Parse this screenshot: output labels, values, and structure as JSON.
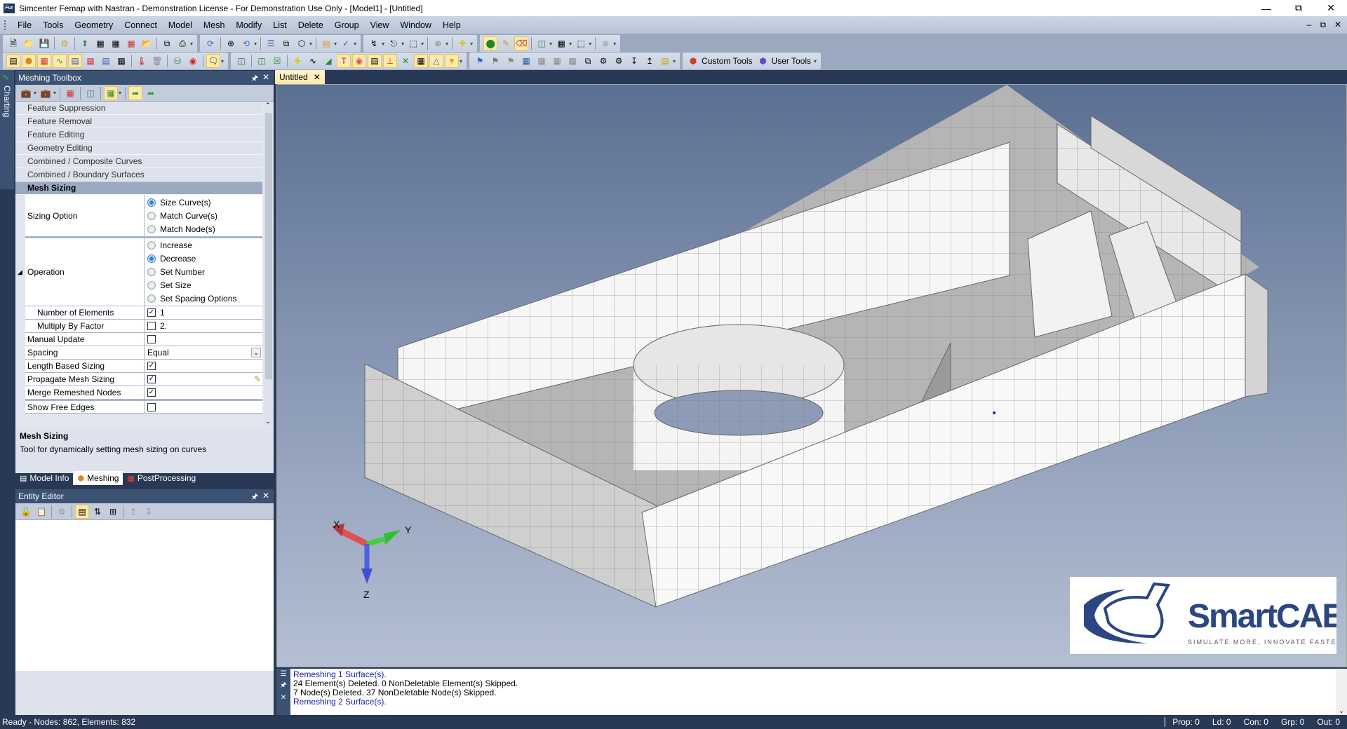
{
  "window": {
    "title": "Simcenter Femap with Nastran - Demonstration License - For Demonstration Use Only - [Model1] - [Untitled]",
    "app_icon": "Fur",
    "controls": [
      "minimize",
      "restore",
      "close"
    ]
  },
  "menu": [
    "File",
    "Tools",
    "Geometry",
    "Connect",
    "Model",
    "Mesh",
    "Modify",
    "List",
    "Delete",
    "Group",
    "View",
    "Window",
    "Help"
  ],
  "toolbar": {
    "custom_tools_label": "Custom Tools",
    "user_tools_label": "User Tools"
  },
  "side_strip": {
    "label": "Charting"
  },
  "meshing_toolbox": {
    "title": "Meshing Toolbox",
    "sections": [
      "Feature Suppression",
      "Feature Removal",
      "Feature Editing",
      "Geometry Editing",
      "Combined / Composite Curves",
      "Combined / Boundary Surfaces"
    ],
    "active_section": "Mesh Sizing",
    "properties": {
      "sizing_option": {
        "label": "Sizing Option",
        "options": [
          "Size Curve(s)",
          "Match Curve(s)",
          "Match Node(s)"
        ],
        "selected": "Size Curve(s)"
      },
      "operation": {
        "label": "Operation",
        "options": [
          "Increase",
          "Decrease",
          "Set Number",
          "Set Size",
          "Set Spacing Options"
        ],
        "selected": "Decrease"
      },
      "number_of_elements": {
        "label": "Number of Elements",
        "checked": true,
        "value": "1"
      },
      "multiply_by_factor": {
        "label": "Multiply By Factor",
        "checked": false,
        "value": "2."
      },
      "manual_update": {
        "label": "Manual Update",
        "checked": false
      },
      "spacing": {
        "label": "Spacing",
        "value": "Equal"
      },
      "length_based_sizing": {
        "label": "Length Based Sizing",
        "checked": true
      },
      "propagate_mesh_sizing": {
        "label": "Propagate Mesh Sizing",
        "checked": true
      },
      "merge_remeshed_nodes": {
        "label": "Merge Remeshed Nodes",
        "checked": true
      },
      "show_free_edges": {
        "label": "Show Free Edges",
        "checked": false
      }
    },
    "description": {
      "title": "Mesh Sizing",
      "text": "Tool for dynamically setting mesh sizing on curves"
    }
  },
  "bottom_tabs": [
    {
      "label": "Model Info",
      "active": false
    },
    {
      "label": "Meshing",
      "active": true
    },
    {
      "label": "PostProcessing",
      "active": false
    }
  ],
  "entity_editor": {
    "title": "Entity Editor"
  },
  "document_tabs": [
    {
      "label": "Untitled",
      "active": true
    }
  ],
  "viewport": {
    "axes": {
      "x": "X",
      "y": "Y",
      "z": "Z"
    },
    "colors": {
      "x": "#e05050",
      "y": "#40d040",
      "z": "#5060e0"
    },
    "logo": {
      "name": "SmartCAE",
      "tagline": "SIMULATE MORE, INNOVATE FASTER",
      "color": "#2b4680"
    }
  },
  "messages": [
    {
      "text": "Remeshing 1 Surface(s).",
      "color": "blue"
    },
    {
      "text": "24 Element(s) Deleted. 0 NonDeletable Element(s) Skipped.",
      "color": "black"
    },
    {
      "text": "7 Node(s) Deleted. 37 NonDeletable Node(s) Skipped.",
      "color": "black"
    },
    {
      "text": "Remeshing 2 Surface(s).",
      "color": "blue"
    }
  ],
  "status": {
    "left": "Ready - Nodes: 862,  Elements: 832",
    "right": [
      "Prop: 0",
      "Ld: 0",
      "Con: 0",
      "Grp: 0",
      "Out: 0"
    ]
  }
}
